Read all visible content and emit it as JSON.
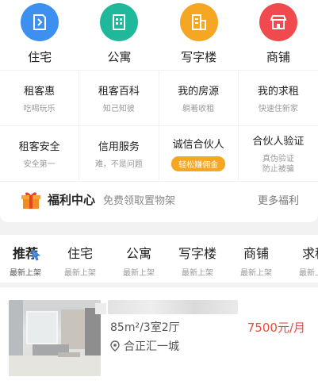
{
  "categories": [
    {
      "label": "住宅",
      "icon": "house-icon",
      "color": "#3d8ff0"
    },
    {
      "label": "公寓",
      "icon": "apartment-icon",
      "color": "#1fb89b"
    },
    {
      "label": "写字楼",
      "icon": "office-icon",
      "color": "#f5a623"
    },
    {
      "label": "商铺",
      "icon": "shop-icon",
      "color": "#f04a4f"
    }
  ],
  "services": [
    {
      "title": "租客惠",
      "sub": "吃喝玩乐"
    },
    {
      "title": "租客百科",
      "sub": "知己知彼"
    },
    {
      "title": "我的房源",
      "sub": "躺着收租"
    },
    {
      "title": "我的求租",
      "sub": "快速住新家"
    },
    {
      "title": "租客安全",
      "sub": "安全第一"
    },
    {
      "title": "信用服务",
      "sub": "难，不是问题"
    },
    {
      "title": "诚信合伙人",
      "pill": "轻松赚佣金"
    },
    {
      "title": "合伙人验证",
      "sub1": "真伪验证",
      "sub2": "防止被骗"
    }
  ],
  "welfare": {
    "title": "福利中心",
    "subtitle": "免费领取置物架",
    "more": "更多福利"
  },
  "tabs": [
    {
      "name": "推荐",
      "sub": "最新上架"
    },
    {
      "name": "住宅",
      "sub": "最新上架"
    },
    {
      "name": "公寓",
      "sub": "最新上架"
    },
    {
      "name": "写字楼",
      "sub": "最新上架"
    },
    {
      "name": "商铺",
      "sub": "最新上架"
    },
    {
      "name": "求租",
      "sub": "最新上架"
    }
  ],
  "listing": {
    "spec": "85m²/3室2厅",
    "location": "合正汇一城",
    "price": "7500元/月"
  }
}
